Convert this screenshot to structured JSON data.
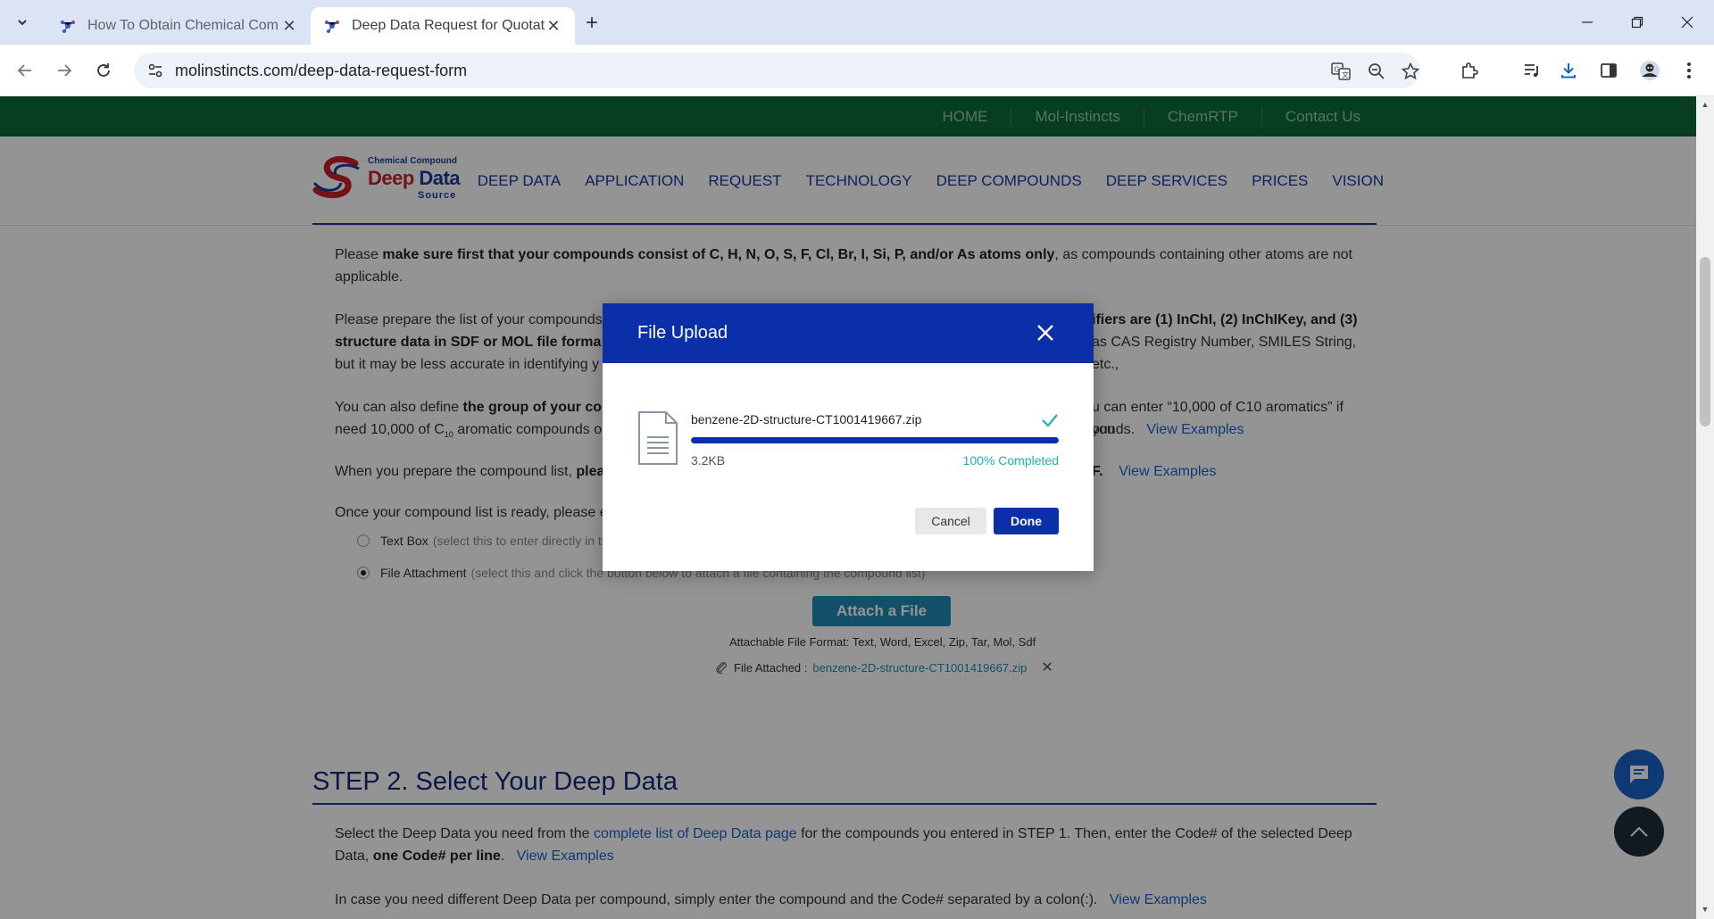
{
  "browser": {
    "tabs": [
      {
        "title": "How To Obtain Chemical Com"
      },
      {
        "title": "Deep Data Request for Quotat"
      }
    ],
    "url": "molinstincts.com/deep-data-request-form"
  },
  "topnav": {
    "links": [
      "HOME",
      "Mol-Instincts",
      "ChemRTP",
      "Contact Us"
    ]
  },
  "logo": {
    "sub": "Chemical Compound",
    "main_a": "Deep ",
    "main_b": "Data",
    "src": "Source"
  },
  "mainnav": {
    "items": [
      "DEEP DATA",
      "APPLICATION",
      "REQUEST",
      "TECHNOLOGY",
      "DEEP COMPOUNDS",
      "DEEP SERVICES",
      "PRICES",
      "VISION"
    ]
  },
  "content": {
    "p1_a": "Please ",
    "p1_b": "make sure first that your compounds consist of C, H, N, O, S, F, Cl, Br, I, Si, P, and/or As atoms only",
    "p1_c": ", as compounds containing other atoms are not applicable.",
    "p2_a": "Please prepare the list of your compounds",
    "p2_b": "ifiers are (1) InChI, (2) InChIKey, and (3)",
    "p2_c": "structure data in SDF or MOL file forma",
    "p2_d": "as CAS Registry Number, SMILES String, etc.,",
    "p2_e": "but it may be less accurate in identifying y",
    "p3_a": "You can also define ",
    "p3_b": "the group of your co",
    "p3_c": "u can enter “10,000 of C10 aromatics” if you",
    "p3_d": "need 10,000 of C",
    "p3_sub": "10",
    "p3_e": " aromatic compounds o",
    "p3_f": "ounds.",
    "view_examples": "View Examples",
    "p4_a": "When you prepare the compound list, ",
    "p4_b": "plea",
    "p4_c": "F.",
    "p5": "Once your compound list is ready, please e",
    "radio1_label": "Text Box",
    "radio1_hint": "(select this to enter directly in th",
    "radio2_label": "File Attachment",
    "radio2_hint": "(select this and click the button below to attach a file containing the compound list)",
    "attach_button": "Attach a File",
    "formats": "Attachable File Format: Text, Word, Excel, Zip, Tar, Mol, Sdf",
    "attached_label": "File Attached :",
    "attached_file": "benzene-2D-structure-CT1001419667.zip",
    "step2_title": "STEP 2. Select Your Deep Data",
    "s2p1_a": "Select the Deep Data you need from the ",
    "s2p1_link": "complete list of Deep Data page",
    "s2p1_b": " for the compounds you entered in STEP 1. Then, enter the Code# of the selected Deep Data, ",
    "s2p1_bold": "one Code# per line",
    "s2p1_c": ".",
    "s2p2": "In case you need different Deep Data per compound, simply enter the compound and the Code# separated by a colon(:)."
  },
  "modal": {
    "title": "File Upload",
    "filename": "benzene-2D-structure-CT1001419667.zip",
    "size": "3.2KB",
    "progress_pct": 100,
    "status": "100% Completed",
    "cancel": "Cancel",
    "done": "Done"
  },
  "colors": {
    "brand_green": "#0d6b3c",
    "brand_blue": "#1a3aa0",
    "modal_blue": "#0a2fa8",
    "success_teal": "#1fb0b0"
  }
}
